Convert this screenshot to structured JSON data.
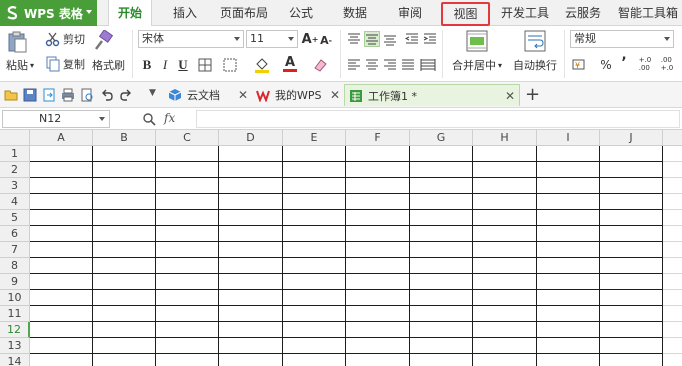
{
  "app": {
    "name": "WPS 表格",
    "accent": "#4a9e3a",
    "highlight_color": "#e0393e"
  },
  "menu": {
    "tabs": [
      {
        "label": "开始",
        "state": "active"
      },
      {
        "label": "插入"
      },
      {
        "label": "页面布局"
      },
      {
        "label": "公式"
      },
      {
        "label": "数据"
      },
      {
        "label": "审阅"
      },
      {
        "label": "视图",
        "state": "highlighted"
      },
      {
        "label": "开发工具"
      },
      {
        "label": "云服务"
      },
      {
        "label": "智能工具箱"
      }
    ]
  },
  "ribbon": {
    "clipboard": {
      "paste": "粘贴",
      "cut": "剪切",
      "copy": "复制",
      "format_painter": "格式刷"
    },
    "font": {
      "name": "宋体",
      "size": "11",
      "bold": "B",
      "italic": "I",
      "underline": "U"
    },
    "merge": "合并居中",
    "wrap": "自动换行",
    "number_format": "常规",
    "percent": "%",
    "comma": "’",
    "increase_decimal": "+.0\n.00",
    "decrease_decimal": ".00\n+.0"
  },
  "doc_tabs": [
    {
      "label": "云文档",
      "icon": "cloud-cube-icon"
    },
    {
      "label": "我的WPS",
      "icon": "wps-w-icon"
    },
    {
      "label": "工作簿1 *",
      "icon": "sheet-icon",
      "active": true
    }
  ],
  "formula_bar": {
    "cell_ref": "N12",
    "fx": "fx",
    "value": ""
  },
  "grid": {
    "columns": [
      "A",
      "B",
      "C",
      "D",
      "E",
      "F",
      "G",
      "H",
      "I",
      "J"
    ],
    "rows": [
      "1",
      "2",
      "3",
      "4",
      "5",
      "6",
      "7",
      "8",
      "9",
      "10",
      "11",
      "12",
      "13",
      "14"
    ],
    "selected_row": "12"
  }
}
